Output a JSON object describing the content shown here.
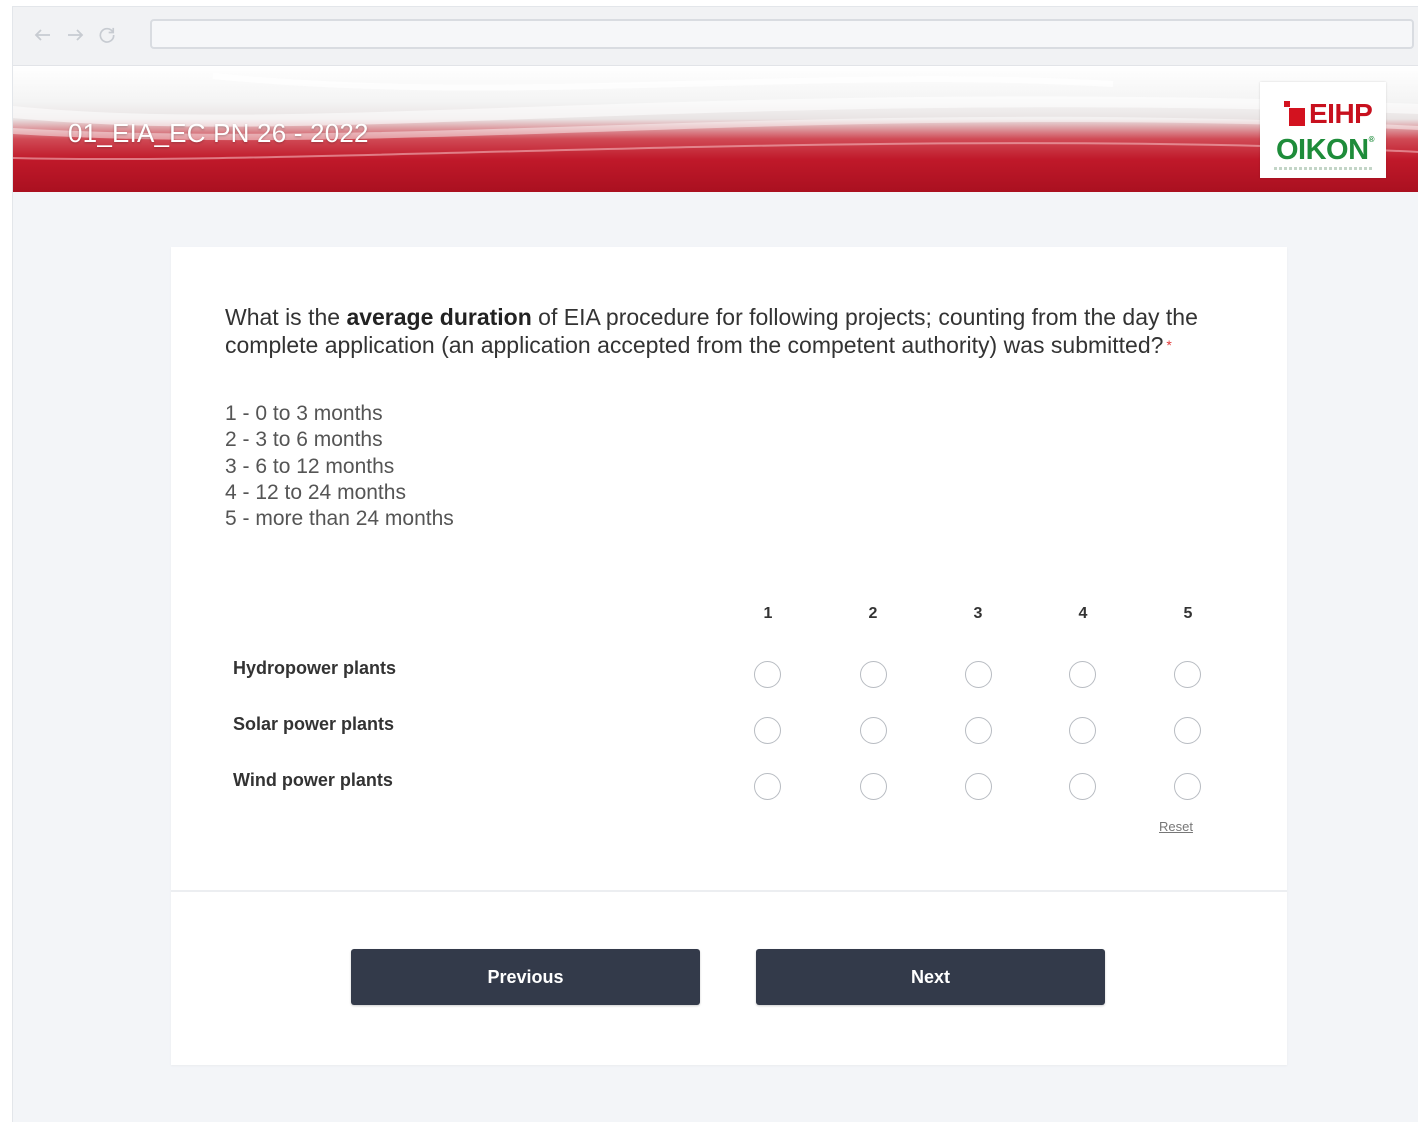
{
  "survey": {
    "title": "01_EIA_EC PN 26 - 2022",
    "logo": {
      "line1": "EIHP",
      "line2": "OIKON"
    }
  },
  "question": {
    "text_before": "What is the ",
    "text_bold": "average duration",
    "text_after": " of EIA procedure for following projects; counting from the day the complete application (an application accepted from the competent authority) was submitted?",
    "required_mark": "*",
    "scale_legend": [
      "1 - 0 to 3 months",
      "2 - 3 to 6 months",
      "3 - 6 to 12 months",
      "4 - 12 to 24 months",
      "5 - more than 24 months"
    ]
  },
  "matrix": {
    "columns": [
      "1",
      "2",
      "3",
      "4",
      "5"
    ],
    "rows": [
      "Hydropower plants",
      "Solar power plants",
      "Wind power plants"
    ],
    "reset_label": "Reset"
  },
  "buttons": {
    "previous": "Previous",
    "next": "Next"
  },
  "colors": {
    "banner_red": "#c0192a",
    "button_bg": "#333a4a",
    "logo_red": "#c8101e",
    "logo_green": "#1e8c3a"
  }
}
